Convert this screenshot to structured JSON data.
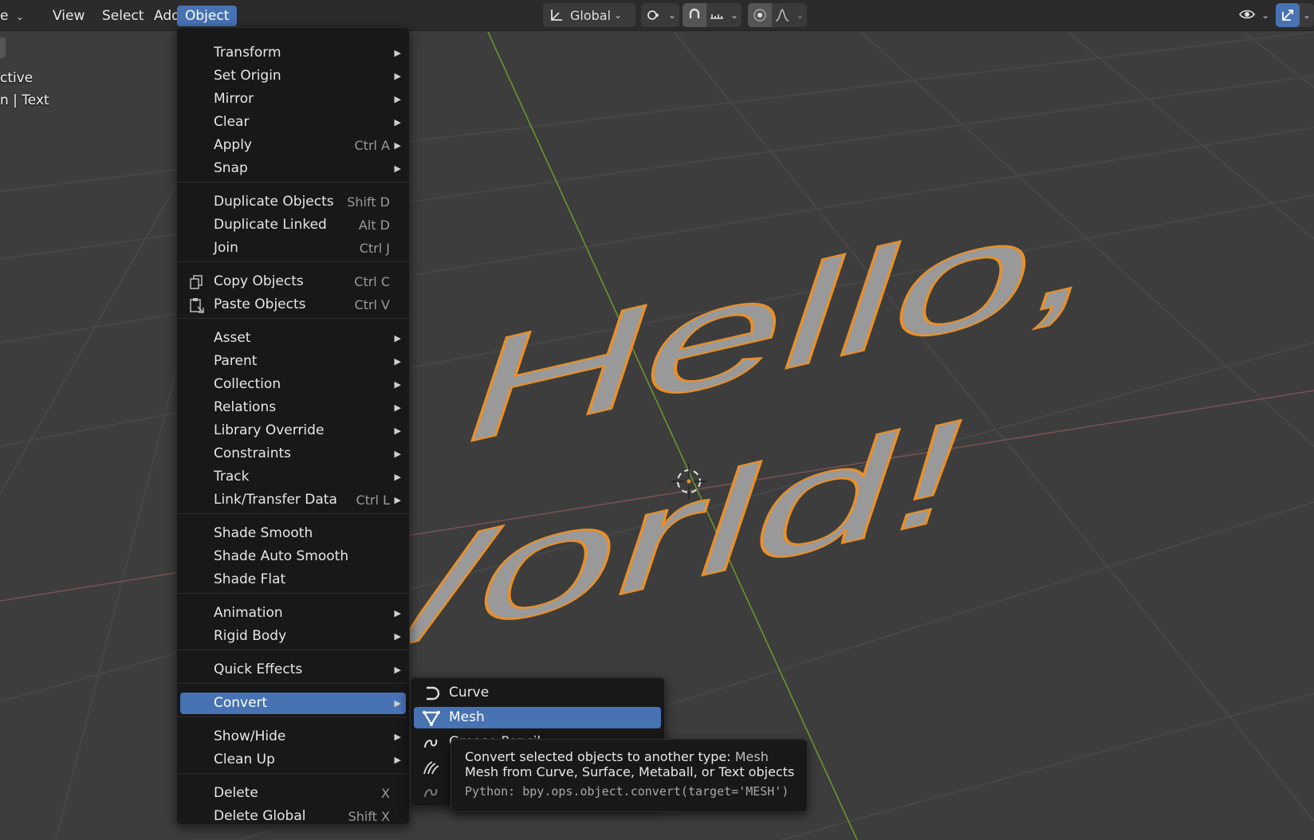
{
  "header": {
    "mode_partial": "e",
    "menus": [
      "View",
      "Select",
      "Add",
      "Object"
    ],
    "active_menu": "Object",
    "transform_orientation": "Global"
  },
  "overlay": {
    "line1": "ctive",
    "line2": "n | Text"
  },
  "viewport_text": {
    "line1": "Hello,",
    "line2": "World!"
  },
  "object_menu": {
    "items": [
      {
        "label": "Transform",
        "shortcut": "",
        "submenu": true
      },
      {
        "label": "Set Origin",
        "shortcut": "",
        "submenu": true
      },
      {
        "label": "Mirror",
        "shortcut": "",
        "submenu": true
      },
      {
        "label": "Clear",
        "shortcut": "",
        "submenu": true
      },
      {
        "label": "Apply",
        "shortcut": "Ctrl A",
        "submenu": true
      },
      {
        "label": "Snap",
        "shortcut": "",
        "submenu": true
      },
      {
        "label": "Duplicate Objects",
        "shortcut": "Shift D",
        "submenu": false
      },
      {
        "label": "Duplicate Linked",
        "shortcut": "Alt D",
        "submenu": false
      },
      {
        "label": "Join",
        "shortcut": "Ctrl J",
        "submenu": false
      },
      {
        "label": "Copy Objects",
        "shortcut": "Ctrl C",
        "submenu": false,
        "icon": "copy-icon"
      },
      {
        "label": "Paste Objects",
        "shortcut": "Ctrl V",
        "submenu": false,
        "icon": "paste-icon"
      },
      {
        "label": "Asset",
        "shortcut": "",
        "submenu": true
      },
      {
        "label": "Parent",
        "shortcut": "",
        "submenu": true
      },
      {
        "label": "Collection",
        "shortcut": "",
        "submenu": true
      },
      {
        "label": "Relations",
        "shortcut": "",
        "submenu": true
      },
      {
        "label": "Library Override",
        "shortcut": "",
        "submenu": true
      },
      {
        "label": "Constraints",
        "shortcut": "",
        "submenu": true
      },
      {
        "label": "Track",
        "shortcut": "",
        "submenu": true
      },
      {
        "label": "Link/Transfer Data",
        "shortcut": "Ctrl L",
        "submenu": true
      },
      {
        "label": "Shade Smooth",
        "shortcut": "",
        "submenu": false
      },
      {
        "label": "Shade Auto Smooth",
        "shortcut": "",
        "submenu": false
      },
      {
        "label": "Shade Flat",
        "shortcut": "",
        "submenu": false
      },
      {
        "label": "Animation",
        "shortcut": "",
        "submenu": true
      },
      {
        "label": "Rigid Body",
        "shortcut": "",
        "submenu": true
      },
      {
        "label": "Quick Effects",
        "shortcut": "",
        "submenu": true
      },
      {
        "label": "Convert",
        "shortcut": "",
        "submenu": true,
        "highlighted": true
      },
      {
        "label": "Show/Hide",
        "shortcut": "",
        "submenu": true
      },
      {
        "label": "Clean Up",
        "shortcut": "",
        "submenu": true
      },
      {
        "label": "Delete",
        "shortcut": "X",
        "submenu": false
      },
      {
        "label": "Delete Global",
        "shortcut": "Shift X",
        "submenu": false
      }
    ]
  },
  "convert_menu": {
    "items": [
      {
        "label": "Curve",
        "icon": "curve-icon"
      },
      {
        "label": "Mesh",
        "icon": "mesh-icon",
        "highlighted": true
      },
      {
        "label": "Grease Pencil",
        "icon": "grease-pencil-icon"
      },
      {
        "label": "",
        "icon": "curves-icon"
      },
      {
        "label": "",
        "icon": "point-cloud-icon"
      }
    ]
  },
  "tooltip": {
    "line1": "Convert selected objects to another type:",
    "line1_value": "Mesh",
    "line2": "Mesh from Curve, Surface, Metaball, or Text objects",
    "python": "Python: bpy.ops.object.convert(target='MESH')"
  },
  "colors": {
    "accent": "#4772b3",
    "menu_bg": "#181818",
    "viewport_bg": "#3d3d3d",
    "selection_outline": "#e8902a",
    "text_fill": "#999999",
    "y_axis": "#6e9a2c",
    "x_axis": "#8a5a5a"
  }
}
